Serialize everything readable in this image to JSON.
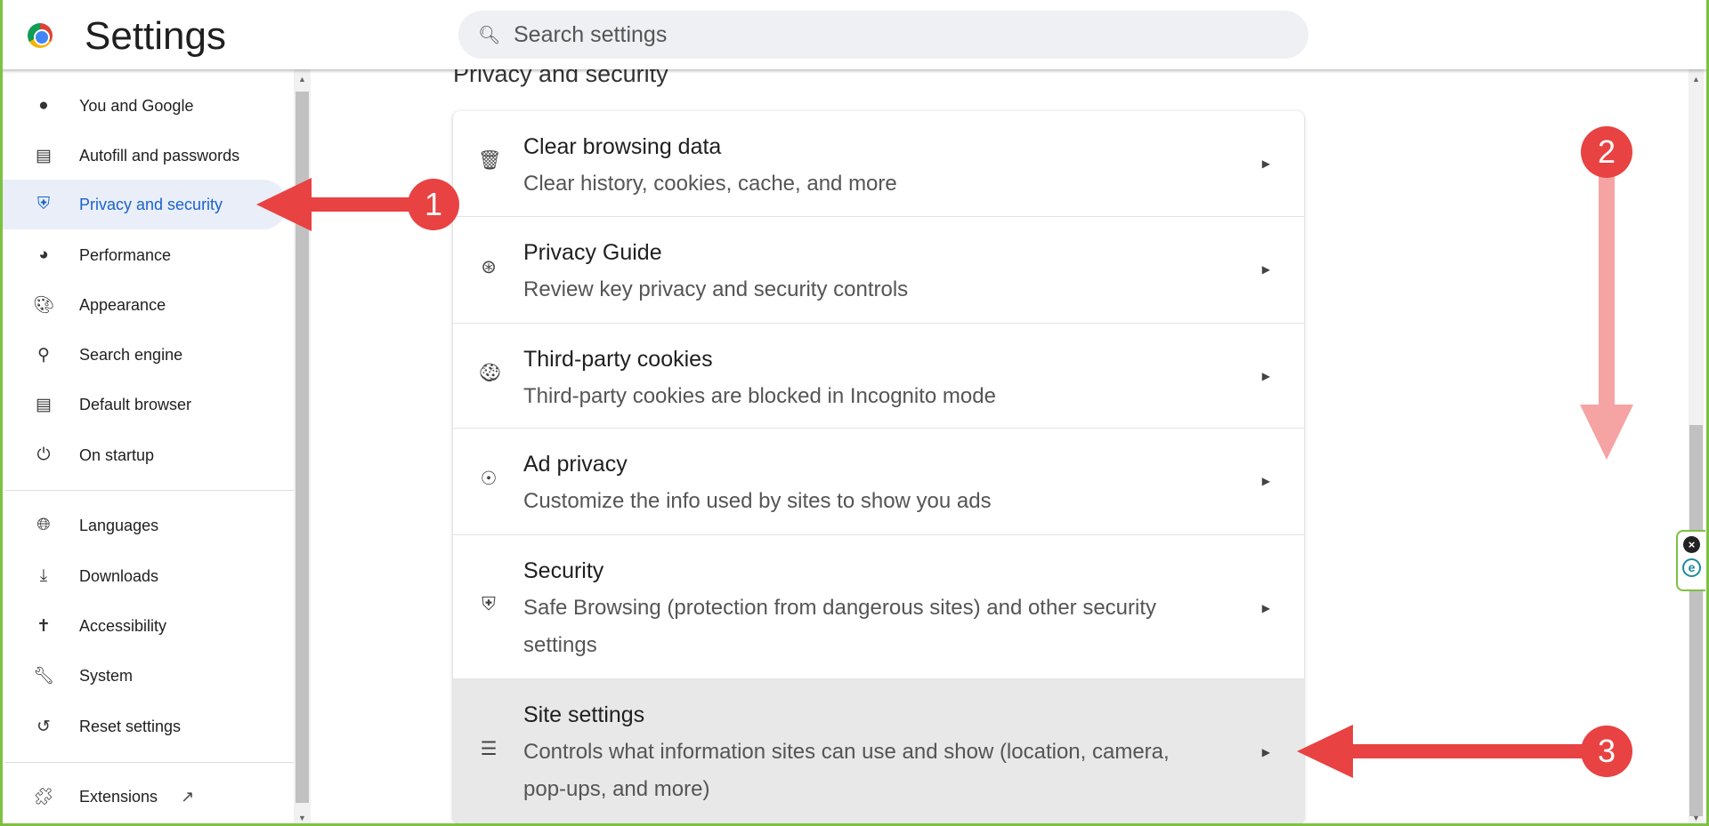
{
  "header": {
    "title": "Settings",
    "search_placeholder": "Search settings"
  },
  "sidebar": {
    "items": [
      {
        "label": "You and Google",
        "icon": "person-icon"
      },
      {
        "label": "Autofill and passwords",
        "icon": "clipboard-icon"
      },
      {
        "label": "Privacy and security",
        "icon": "shield-icon",
        "active": true
      },
      {
        "label": "Performance",
        "icon": "gauge-icon"
      },
      {
        "label": "Appearance",
        "icon": "palette-icon"
      },
      {
        "label": "Search engine",
        "icon": "search-icon"
      },
      {
        "label": "Default browser",
        "icon": "browser-icon"
      },
      {
        "label": "On startup",
        "icon": "power-icon"
      },
      {
        "label": "Languages",
        "icon": "globe-icon"
      },
      {
        "label": "Downloads",
        "icon": "download-icon"
      },
      {
        "label": "Accessibility",
        "icon": "accessibility-icon"
      },
      {
        "label": "System",
        "icon": "wrench-icon"
      },
      {
        "label": "Reset settings",
        "icon": "reset-icon"
      },
      {
        "label": "Extensions",
        "icon": "puzzle-icon"
      }
    ]
  },
  "main": {
    "section_title": "Privacy and security",
    "rows": [
      {
        "title": "Clear browsing data",
        "subtitle": "Clear history, cookies, cache, and more",
        "icon": "trash-icon"
      },
      {
        "title": "Privacy Guide",
        "subtitle": "Review key privacy and security controls",
        "icon": "compass-icon"
      },
      {
        "title": "Third-party cookies",
        "subtitle": "Third-party cookies are blocked in Incognito mode",
        "icon": "cookie-icon"
      },
      {
        "title": "Ad privacy",
        "subtitle": "Customize the info used by sites to show you ads",
        "icon": "ad-privacy-icon"
      },
      {
        "title": "Security",
        "subtitle": "Safe Browsing (protection from dangerous sites) and other security settings",
        "icon": "shield-icon"
      },
      {
        "title": "Site settings",
        "subtitle": "Controls what information sites can use and show (location, camera, pop-ups, and more)",
        "icon": "sliders-icon",
        "highlighted": true
      }
    ]
  },
  "annotations": [
    {
      "label": "1"
    },
    {
      "label": "2"
    },
    {
      "label": "3"
    }
  ],
  "colors": {
    "accent": "#1a63c9",
    "annotation": "#e84242",
    "frame": "#7cc142"
  }
}
